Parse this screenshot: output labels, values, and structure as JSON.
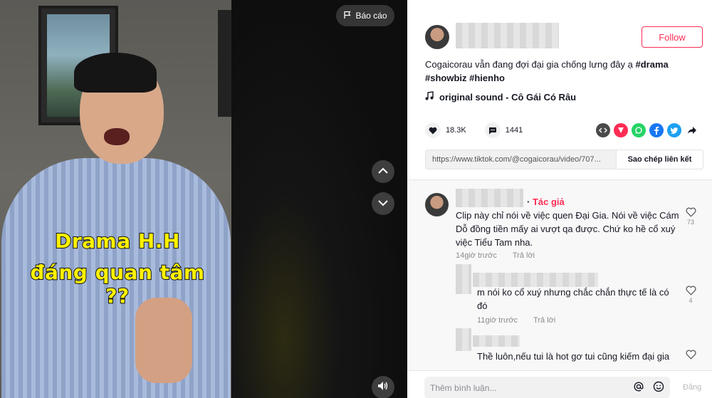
{
  "video": {
    "caption_line1": "Drama H.H",
    "caption_line2": "đáng quan tâm ??",
    "report_label": "Báo cáo"
  },
  "author": {
    "follow_label": "Follow"
  },
  "post": {
    "desc_text": "Cogaicorau vẫn đang đợi đại gia chống lưng đây ạ ",
    "tags": [
      "#drama",
      "#showbiz",
      "#hienho"
    ],
    "music": "original sound - Cô Gái Có Râu"
  },
  "stats": {
    "likes": "18.3K",
    "comments": "1441"
  },
  "share": {
    "icons": [
      "embed-icon",
      "send-icon",
      "whatsapp-icon",
      "facebook-icon",
      "twitter-icon",
      "share-arrow-icon"
    ],
    "colors": {
      "embed": "#4a4a4a",
      "send": "#fe2c55",
      "whatsapp": "#25d366",
      "facebook": "#1877f2",
      "twitter": "#1da1f2"
    }
  },
  "link": {
    "url": "https://www.tiktok.com/@cogaicorau/video/707...",
    "copy_label": "Sao chép liên kết"
  },
  "comments": [
    {
      "author_tag": "Tác giả",
      "text": "Clip này chỉ nói về việc quen Đại Gia. Nói về việc Cám Dỗ đồng tiền mấy ai vượt qa được. Chứ ko hề cổ xuý việc Tiểu Tam nha.",
      "time": "14giờ trước",
      "reply": "Trả lời",
      "likes": "73"
    },
    {
      "text": "m nói ko cổ xuý nhưng chắc chắn thực tế là có đó",
      "time": "11giờ trước",
      "reply": "Trả lời",
      "likes": "4"
    },
    {
      "text": "Thề luôn,nếu tui là hot gơ tui cũng kiếm đại gia"
    }
  ],
  "input": {
    "placeholder": "Thêm bình luận...",
    "post_label": "Đăng"
  }
}
